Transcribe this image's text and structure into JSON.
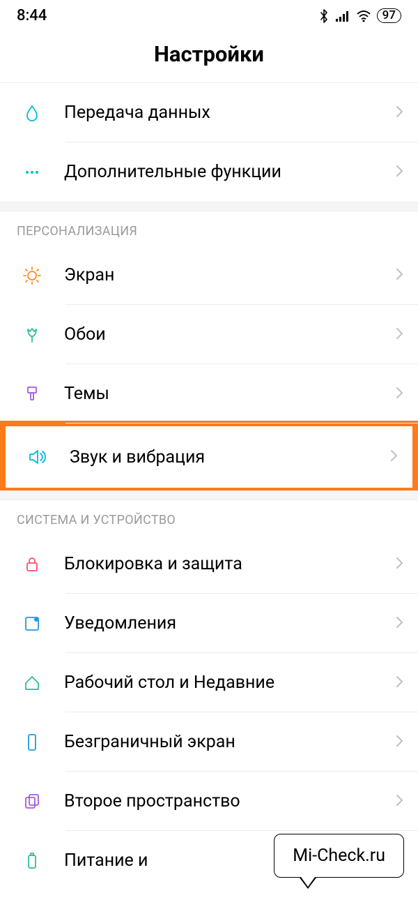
{
  "status": {
    "time": "8:44",
    "battery": "97"
  },
  "header": {
    "title": "Настройки"
  },
  "groups": [
    {
      "header": null,
      "items": [
        {
          "id": "data-transfer",
          "label": "Передача данных",
          "icon": "drop",
          "color": "#00bcd4"
        },
        {
          "id": "more-features",
          "label": "Дополнительные функции",
          "icon": "dots",
          "color": "#00bcd4"
        }
      ]
    },
    {
      "header": "ПЕРСОНАЛИЗАЦИЯ",
      "items": [
        {
          "id": "display",
          "label": "Экран",
          "icon": "sun",
          "color": "#ff8c1a"
        },
        {
          "id": "wallpaper",
          "label": "Обои",
          "icon": "tulip",
          "color": "#2ebd9b"
        },
        {
          "id": "themes",
          "label": "Темы",
          "icon": "brush",
          "color": "#a15ae0"
        },
        {
          "id": "sound-vibration",
          "label": "Звук и вибрация",
          "icon": "speaker",
          "color": "#00bcd4",
          "highlight": true
        }
      ]
    },
    {
      "header": "СИСТЕМА И УСТРОЙСТВО",
      "items": [
        {
          "id": "lock-security",
          "label": "Блокировка и защита",
          "icon": "lock",
          "color": "#ff4d6a"
        },
        {
          "id": "notifications",
          "label": "Уведомления",
          "icon": "notif",
          "color": "#1e9be0"
        },
        {
          "id": "home-recents",
          "label": "Рабочий стол и Недавние",
          "icon": "home",
          "color": "#2ebd9b"
        },
        {
          "id": "full-screen",
          "label": "Безграничный экран",
          "icon": "phone",
          "color": "#1e9be0"
        },
        {
          "id": "second-space",
          "label": "Второе пространство",
          "icon": "dual",
          "color": "#a15ae0"
        },
        {
          "id": "battery-perf",
          "label": "Питание и",
          "icon": "battery",
          "color": "#2ebd9b"
        }
      ]
    }
  ],
  "tooltip": {
    "text": "Mi-Check.ru"
  }
}
